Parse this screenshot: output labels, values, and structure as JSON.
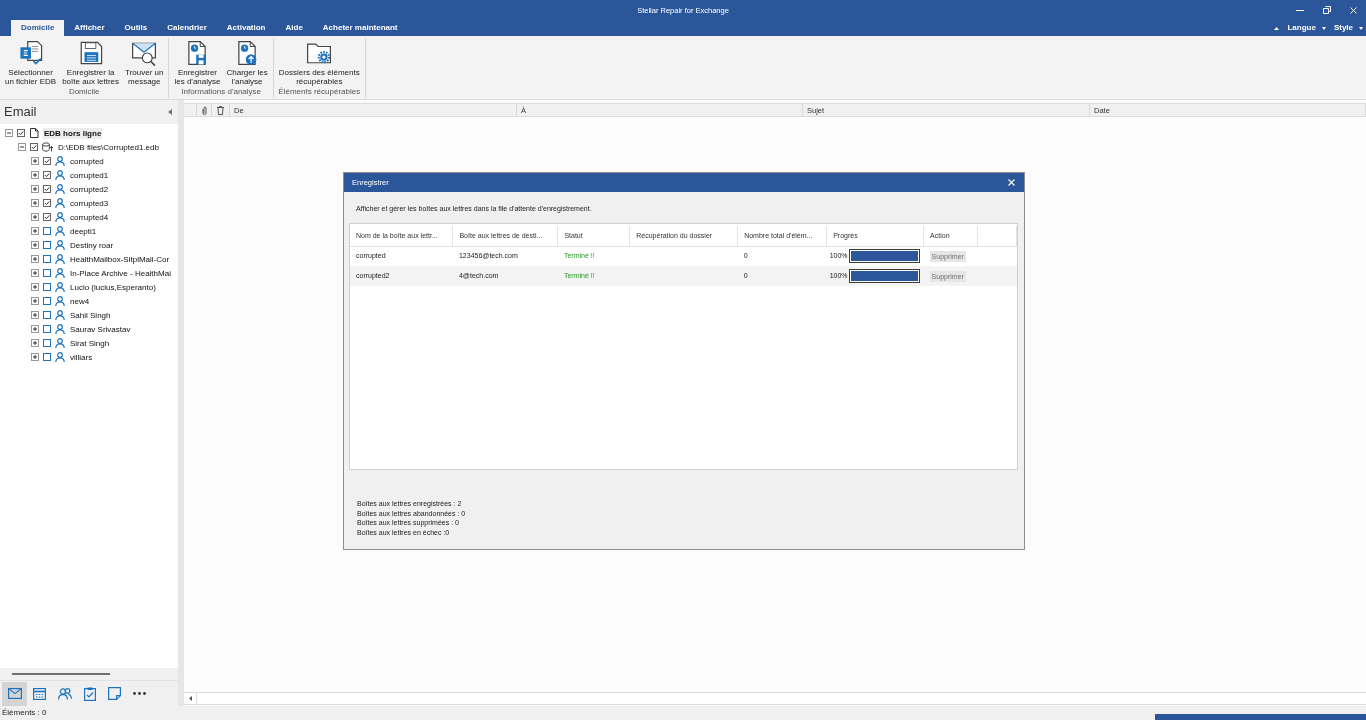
{
  "window": {
    "title": "Stellar Repair for Exchange",
    "controls": [
      {
        "kind": "minimize"
      },
      {
        "kind": "restore"
      },
      {
        "kind": "close"
      }
    ]
  },
  "ribbon": {
    "tabs": [
      {
        "label": "Domicile",
        "selected": true
      },
      {
        "label": "Afficher",
        "selected": false
      },
      {
        "label": "Outils",
        "selected": false
      },
      {
        "label": "Calendrier",
        "selected": false
      },
      {
        "label": "Activation",
        "selected": false
      },
      {
        "label": "Aide",
        "selected": false
      },
      {
        "label": "Acheter maintenant",
        "selected": false
      }
    ],
    "menus": [
      {
        "label": "Langue"
      },
      {
        "label": "Style"
      }
    ],
    "groups": [
      {
        "label": "Domicile",
        "buttons": [
          {
            "kind": "select-edb",
            "label": "Sélectionner\nun fichier EDB"
          },
          {
            "kind": "save-mailbox",
            "label": "Enregistrer la\nboîte aux lettres"
          },
          {
            "kind": "find-message",
            "label": "Trouver un\nmessage"
          }
        ]
      },
      {
        "label": "Informations d'analyse",
        "buttons": [
          {
            "kind": "save-scan",
            "label": "Enregistrer\nles d'analyse"
          },
          {
            "kind": "load-scan",
            "label": "Charger les\nl'analyse"
          }
        ]
      },
      {
        "label": "Éléments récupérables",
        "buttons": [
          {
            "kind": "recoverable-folders",
            "label": "Dossiers des éléments\nrécupérables"
          }
        ]
      }
    ]
  },
  "sidebar": {
    "title": "Email",
    "tree": [
      {
        "label": "EDB hors ligne",
        "kind": "root",
        "expanded": true,
        "checked": true,
        "selected": true,
        "children": [
          {
            "label": "D:\\EDB files\\Corrupted1.edb",
            "kind": "database",
            "expanded": true,
            "checked": true,
            "selected": false,
            "children": [
              {
                "label": "corrupted",
                "kind": "mailbox",
                "expanded": false,
                "checked": true,
                "selected": false
              },
              {
                "label": "corrupted1",
                "kind": "mailbox",
                "expanded": false,
                "checked": true,
                "selected": false
              },
              {
                "label": "corrupted2",
                "kind": "mailbox",
                "expanded": false,
                "checked": true,
                "selected": false
              },
              {
                "label": "corrupted3",
                "kind": "mailbox",
                "expanded": false,
                "checked": true,
                "selected": false
              },
              {
                "label": "corrupted4",
                "kind": "mailbox",
                "expanded": false,
                "checked": true,
                "selected": false
              },
              {
                "label": "deepti1",
                "kind": "mailbox",
                "expanded": false,
                "checked": false,
                "selected": false
              },
              {
                "label": "Destiny roar",
                "kind": "mailbox",
                "expanded": false,
                "checked": false,
                "selected": false
              },
              {
                "label": "HealthMailbox-SitplMail-Cor",
                "kind": "mailbox",
                "expanded": false,
                "checked": false,
                "selected": false
              },
              {
                "label": "In-Place Archive - HealthMai",
                "kind": "mailbox",
                "expanded": false,
                "checked": false,
                "selected": false
              },
              {
                "label": "Lucio (lucius,Esperanto)",
                "kind": "mailbox",
                "expanded": false,
                "checked": false,
                "selected": false
              },
              {
                "label": "new4",
                "kind": "mailbox",
                "expanded": false,
                "checked": false,
                "selected": false
              },
              {
                "label": "Sahil Singh",
                "kind": "mailbox",
                "expanded": false,
                "checked": false,
                "selected": false
              },
              {
                "label": "Saurav Srivastav",
                "kind": "mailbox",
                "expanded": false,
                "checked": false,
                "selected": false
              },
              {
                "label": "Sirat Singh",
                "kind": "mailbox",
                "expanded": false,
                "checked": false,
                "selected": false
              },
              {
                "label": "villiars",
                "kind": "mailbox",
                "expanded": false,
                "checked": false,
                "selected": false
              }
            ]
          }
        ]
      }
    ],
    "nav": [
      {
        "kind": "mail",
        "selected": true
      },
      {
        "kind": "calendar",
        "selected": false
      },
      {
        "kind": "contacts",
        "selected": false
      },
      {
        "kind": "tasks",
        "selected": false
      },
      {
        "kind": "notes",
        "selected": false
      },
      {
        "kind": "more",
        "selected": false
      }
    ]
  },
  "message_list": {
    "columns": [
      {
        "kind": "attachment"
      },
      {
        "kind": "delete"
      },
      {
        "kind": "text",
        "label": "De"
      },
      {
        "kind": "text",
        "label": "À"
      },
      {
        "kind": "text",
        "label": "Sujet"
      },
      {
        "kind": "text",
        "label": "Date"
      }
    ]
  },
  "dialog": {
    "title": "Enregistrer",
    "description": "Afficher et gérer les boîtes aux lettres dans la file d'attente d'enregistrement.",
    "columns": [
      "Nom de la boîte aux lettr...",
      "Boîte aux lettres de desti...",
      "Statut",
      "Récupération du dossier",
      "Nombre total d'élém...",
      "Progrès",
      "Action"
    ],
    "rows": [
      {
        "mailbox": "corrupted",
        "destination": "123456@tech.com",
        "status": "Terminé !!",
        "total": "0",
        "progress": "100%",
        "level": 1,
        "action": "Supprimer",
        "disabled": true
      },
      {
        "mailbox": "corrupted2",
        "destination": "4@tech.com",
        "status": "Terminé !!",
        "total": "0",
        "progress": "100%",
        "level": 1,
        "action": "Supprimer",
        "disabled": true
      }
    ],
    "summary": [
      "Boîtes aux lettres enregistrées : 2",
      "Boîtes aux lettres abandonnées : 0",
      "Boîtes aux lettres supprimées : 0",
      "Boîtes aux lettres en échec :0"
    ]
  },
  "status_bar": {
    "text": "Éléments : 0"
  }
}
